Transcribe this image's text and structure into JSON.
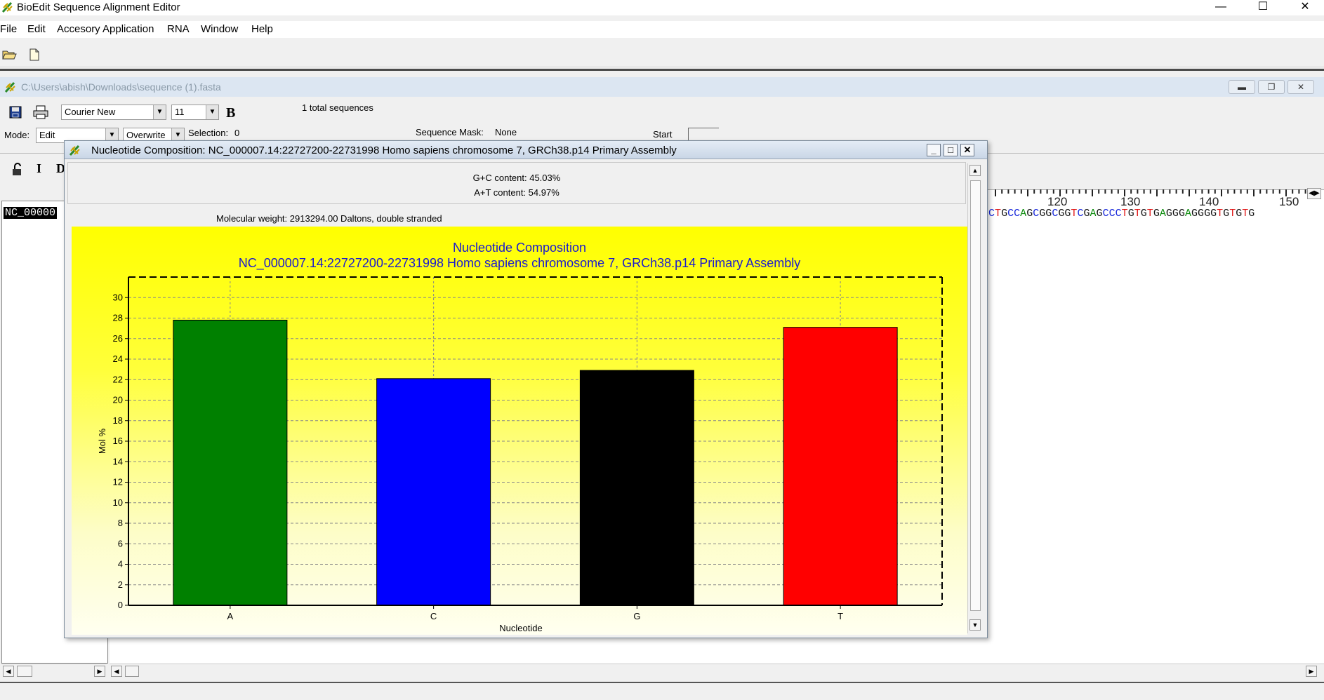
{
  "app": {
    "title": "BioEdit Sequence Alignment Editor",
    "menu": [
      "File",
      "Edit",
      "Accesory Application",
      "RNA",
      "Window",
      "Help"
    ]
  },
  "toolbar": {
    "icons": [
      "open-folder-icon",
      "new-document-icon"
    ]
  },
  "document": {
    "path": "C:\\Users\\abish\\Downloads\\sequence (1).fasta",
    "font": "Courier New",
    "font_size": "11",
    "bold_label": "B",
    "total_sequences": "1 total sequences",
    "mode_label": "Mode:",
    "mode_value": "Edit",
    "overwrite_value": "Overwrite",
    "selection_label": "Selection:",
    "selection_value": "0",
    "sequence_mask_label": "Sequence Mask:",
    "sequence_mask_value": "None",
    "start_label": "Start",
    "format_buttons": [
      "I",
      "D"
    ],
    "sequence_name": "NC_00000",
    "ruler_ticks": [
      "120",
      "130",
      "140",
      "150"
    ],
    "sequence_fragment": "CTGCCAGCGGCGGTCGAGCCCTGTGTGAGGGAGGGGTGTGTG"
  },
  "dialog": {
    "title": "Nucleotide Composition: NC_000007.14:22727200-22731998 Homo sapiens chromosome 7, GRCh38.p14 Primary Assembly",
    "gc_content": "G+C content: 45.03%",
    "at_content": "A+T content: 54.97%",
    "molecular_weight": "Molecular weight: 2913294.00 Daltons, double stranded"
  },
  "chart_data": {
    "type": "bar",
    "title": "Nucleotide Composition",
    "subtitle": "NC_000007.14:22727200-22731998 Homo sapiens chromosome 7, GRCh38.p14 Primary Assembly",
    "xlabel": "Nucleotide",
    "ylabel": "Mol %",
    "categories": [
      "A",
      "C",
      "G",
      "T"
    ],
    "values": [
      27.8,
      22.1,
      22.9,
      27.1
    ],
    "colors": [
      "#008000",
      "#0000ff",
      "#000000",
      "#ff0000"
    ],
    "ylim": [
      0,
      32
    ],
    "yticks": [
      0,
      2,
      4,
      6,
      8,
      10,
      12,
      14,
      16,
      18,
      20,
      22,
      24,
      26,
      28,
      30
    ],
    "grid": true,
    "background": "#ffff00"
  }
}
